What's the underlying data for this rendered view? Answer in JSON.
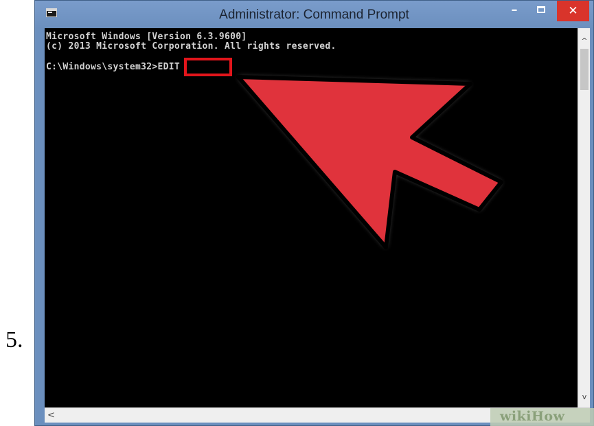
{
  "step_number": "5.",
  "window": {
    "title": "Administrator: Command Prompt",
    "icon": "cmd-icon",
    "controls": {
      "minimize": "–",
      "maximize": "maximize-icon",
      "close": "✕"
    }
  },
  "console": {
    "lines": [
      "Microsoft Windows [Version 6.3.9600]",
      "(c) 2013 Microsoft Corporation. All rights reserved.",
      "C:\\Windows\\system32>EDIT"
    ],
    "highlighted_command": ">EDIT"
  },
  "scrollbars": {
    "up": "^",
    "down": "v",
    "left": "<"
  },
  "watermark": "wikiHow",
  "colors": {
    "console_bg": "#000000",
    "console_text": "#d3d3d3",
    "highlight_border": "#e2151b",
    "arrow_fill": "#e0333c",
    "titlebar": "#6b8fbe",
    "close_button": "#d9342b"
  }
}
